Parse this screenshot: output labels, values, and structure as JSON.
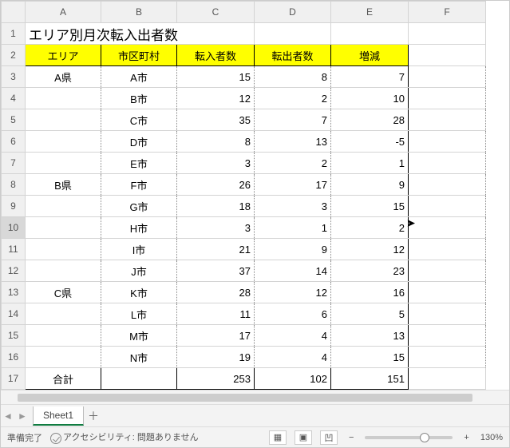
{
  "columns": [
    "A",
    "B",
    "C",
    "D",
    "E",
    "F"
  ],
  "title": "エリア別月次転入出者数",
  "headers": {
    "area": "エリア",
    "muni": "市区町村",
    "in": "転入者数",
    "out": "転出者数",
    "diff": "増減"
  },
  "rows": [
    {
      "area": "A県",
      "muni": "A市",
      "in": 15,
      "out": 8,
      "diff": 7
    },
    {
      "area": "",
      "muni": "B市",
      "in": 12,
      "out": 2,
      "diff": 10
    },
    {
      "area": "",
      "muni": "C市",
      "in": 35,
      "out": 7,
      "diff": 28
    },
    {
      "area": "",
      "muni": "D市",
      "in": 8,
      "out": 13,
      "diff": -5
    },
    {
      "area": "",
      "muni": "E市",
      "in": 3,
      "out": 2,
      "diff": 1
    },
    {
      "area": "B県",
      "muni": "F市",
      "in": 26,
      "out": 17,
      "diff": 9
    },
    {
      "area": "",
      "muni": "G市",
      "in": 18,
      "out": 3,
      "diff": 15
    },
    {
      "area": "",
      "muni": "H市",
      "in": 3,
      "out": 1,
      "diff": 2
    },
    {
      "area": "",
      "muni": "I市",
      "in": 21,
      "out": 9,
      "diff": 12
    },
    {
      "area": "",
      "muni": "J市",
      "in": 37,
      "out": 14,
      "diff": 23
    },
    {
      "area": "C県",
      "muni": "K市",
      "in": 28,
      "out": 12,
      "diff": 16
    },
    {
      "area": "",
      "muni": "L市",
      "in": 11,
      "out": 6,
      "diff": 5
    },
    {
      "area": "",
      "muni": "M市",
      "in": 17,
      "out": 4,
      "diff": 13
    },
    {
      "area": "",
      "muni": "N市",
      "in": 19,
      "out": 4,
      "diff": 15
    }
  ],
  "total": {
    "label": "合計",
    "in": 253,
    "out": 102,
    "diff": 151
  },
  "sheet_tab": "Sheet1",
  "status": {
    "ready": "準備完了",
    "accessibility": "アクセシビリティ: 問題ありません",
    "zoom": "130%",
    "minus": "−",
    "plus": "+"
  },
  "selected_row": 10,
  "selected_col": "F",
  "chart_data": {
    "type": "table",
    "title": "エリア別月次転入出者数",
    "columns": [
      "エリア",
      "市区町村",
      "転入者数",
      "転出者数",
      "増減"
    ],
    "rows": [
      [
        "A県",
        "A市",
        15,
        8,
        7
      ],
      [
        "A県",
        "B市",
        12,
        2,
        10
      ],
      [
        "A県",
        "C市",
        35,
        7,
        28
      ],
      [
        "A県",
        "D市",
        8,
        13,
        -5
      ],
      [
        "A県",
        "E市",
        3,
        2,
        1
      ],
      [
        "B県",
        "F市",
        26,
        17,
        9
      ],
      [
        "B県",
        "G市",
        18,
        3,
        15
      ],
      [
        "B県",
        "H市",
        3,
        1,
        2
      ],
      [
        "B県",
        "I市",
        21,
        9,
        12
      ],
      [
        "B県",
        "J市",
        37,
        14,
        23
      ],
      [
        "C県",
        "K市",
        28,
        12,
        16
      ],
      [
        "C県",
        "L市",
        11,
        6,
        5
      ],
      [
        "C県",
        "M市",
        17,
        4,
        13
      ],
      [
        "C県",
        "N市",
        19,
        4,
        15
      ]
    ],
    "totals": {
      "転入者数": 253,
      "転出者数": 102,
      "増減": 151
    }
  }
}
